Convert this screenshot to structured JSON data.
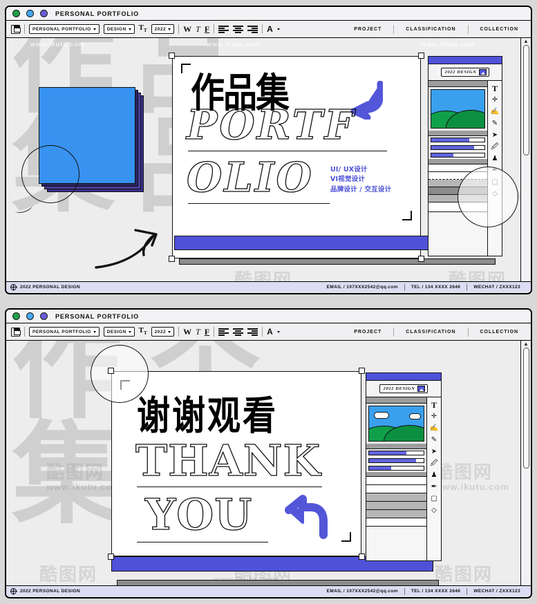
{
  "app": {
    "accent": "#4f52d9",
    "blue_card": "#3892f0",
    "window_title": "PERSONAL PORTFOLIO"
  },
  "windows": [
    {
      "id": "window-1",
      "titlebar": {
        "title": "PERSONAL PORTFOLIO",
        "dots": [
          "green",
          "blue",
          "purple"
        ]
      },
      "toolbar": {
        "save_icon": "save-icon",
        "doc_select": "PERSONAL PORTFOLIO",
        "category_select": "DESIGN",
        "font_size_icon": "Tт",
        "year_select": "2022",
        "bold": "W",
        "italic": "T",
        "underline": "F",
        "align_left": "align-left-icon",
        "align_center": "align-center-icon",
        "align_right": "align-right-icon",
        "text_color": "A",
        "nav": [
          "PROJECT",
          "CLASSIFICATION",
          "COLLECTION"
        ]
      },
      "canvas": {
        "bg_chars": "作品\n集品",
        "artboard": {
          "cn_title": "作品集",
          "outline_line1": "PORTF",
          "outline_line2": "OLIO",
          "tags": [
            "UI/ UX设计",
            "VI视觉设计",
            "品牌设计 / 交互设计"
          ],
          "arrow": "arrow-down-left"
        },
        "panel": {
          "chip_label": "2022 DESIGN",
          "sliders": [
            72,
            80,
            42
          ],
          "tools": [
            "text-tool",
            "move-tool",
            "hand-tool",
            "eyedropper-tool",
            "pointer-tool",
            "eraser-tool",
            "stamp-tool",
            "pen-tool",
            "shape-tool",
            "paint-bucket-tool"
          ]
        }
      },
      "footer": {
        "copyright": "2022 PERSONAL DESIGN",
        "email": "EMAIL / 107XXX2542@qq.com",
        "tel": "TEL / 134 XXXX 2646",
        "wechat": "WECHAT / ZXXX123"
      }
    },
    {
      "id": "window-2",
      "titlebar": {
        "title": "PERSONAL PORTFOLIO",
        "dots": [
          "green",
          "blue",
          "purple"
        ]
      },
      "toolbar": {
        "doc_select": "PERSONAL PORTFOLIO",
        "category_select": "DESIGN",
        "year_select": "2022",
        "nav": [
          "PROJECT",
          "CLASSIFICATION",
          "COLLECTION"
        ]
      },
      "canvas": {
        "bg_chars": "作个\n集作",
        "artboard": {
          "cn_title": "谢谢观看",
          "outline_line1": "THANK",
          "outline_line2": "YOU",
          "arrow": "arrow-up-left"
        },
        "panel": {
          "chip_label": "2022 DESIGN",
          "sliders": [
            68,
            86,
            40
          ]
        }
      },
      "footer": {
        "copyright": "2022 PERSONAL DESIGN",
        "email": "EMAIL / 107XXX2542@qq.com",
        "tel": "TEL / 134 XXXX 2646",
        "wechat": "WECHAT / ZXXX123"
      }
    }
  ],
  "watermark": {
    "url": "www.ikutu.com",
    "brand": "酷图网"
  }
}
